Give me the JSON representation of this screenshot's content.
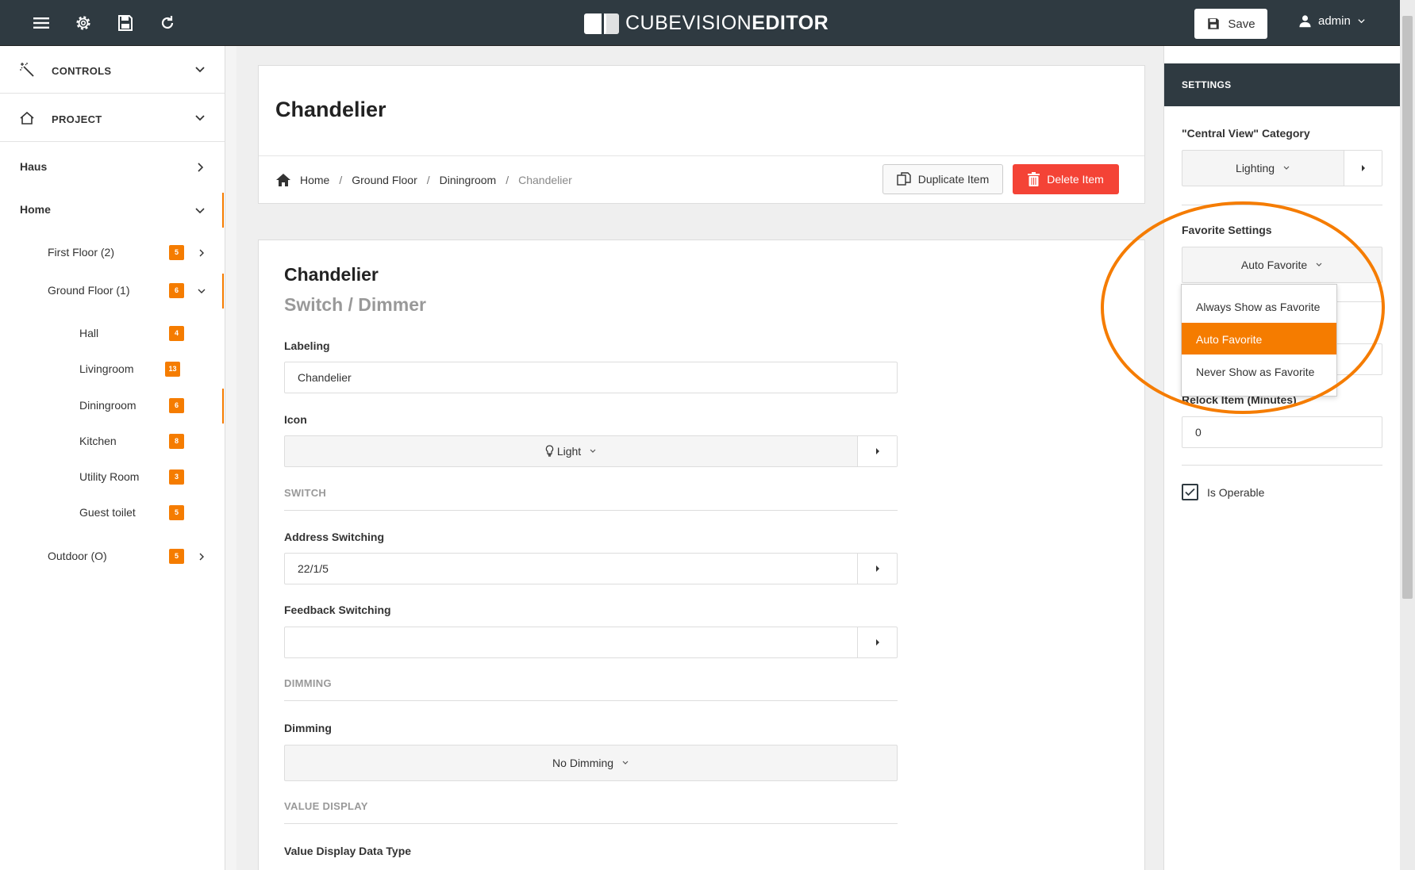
{
  "app": {
    "brand_light": "CUBEVISION",
    "brand_bold": "EDITOR"
  },
  "topbar": {
    "icons": [
      "menu-icon",
      "gear-icon",
      "floppy-icon",
      "refresh-icon"
    ],
    "save_label": "Save",
    "user_label": "admin"
  },
  "sidebar": {
    "controls_label": "CONTROLS",
    "project_label": "PROJECT",
    "items": [
      {
        "label": "Haus",
        "level": 0
      },
      {
        "label": "Home",
        "level": 0
      },
      {
        "label": "First Floor (2)",
        "badge": "5",
        "level": 1
      },
      {
        "label": "Ground Floor (1)",
        "badge": "6",
        "level": 1
      },
      {
        "label": "Hall",
        "badge": "4",
        "level": 2
      },
      {
        "label": "Livingroom",
        "badge": "13",
        "level": 2
      },
      {
        "label": "Diningroom",
        "badge": "6",
        "level": 2
      },
      {
        "label": "Kitchen",
        "badge": "8",
        "level": 2
      },
      {
        "label": "Utility Room",
        "badge": "3",
        "level": 2
      },
      {
        "label": "Guest toilet",
        "badge": "5",
        "level": 2
      },
      {
        "label": "Outdoor (O)",
        "badge": "5",
        "level": 1
      }
    ]
  },
  "page": {
    "title": "Chandelier",
    "breadcrumb": [
      "Home",
      "Ground Floor",
      "Diningroom",
      "Chandelier"
    ],
    "duplicate_label": "Duplicate Item",
    "delete_label": "Delete Item"
  },
  "form": {
    "title": "Chandelier",
    "subtitle": "Switch / Dimmer",
    "labeling_label": "Labeling",
    "labeling_value": "Chandelier",
    "icon_label": "Icon",
    "icon_value": "Light",
    "switch_section": "SWITCH",
    "address_switching_label": "Address Switching",
    "address_switching_value": "22/1/5",
    "feedback_switching_label": "Feedback Switching",
    "feedback_switching_value": "",
    "dimming_section": "DIMMING",
    "dimming_label": "Dimming",
    "dimming_value": "No Dimming",
    "value_display_section": "VALUE DISPLAY",
    "value_display_type_label": "Value Display Data Type"
  },
  "settings": {
    "header": "SETTINGS",
    "central_view_label": "\"Central View\" Category",
    "central_view_value": "Lighting",
    "favorite_label": "Favorite Settings",
    "favorite_value": "Auto Favorite",
    "favorite_options": [
      "Always Show as Favorite",
      "Auto Favorite",
      "Never Show as Favorite"
    ],
    "favorite_selected_index": 1,
    "relock_label": "Relock Item (Minutes)",
    "relock_value": "0",
    "is_operable_label": "Is Operable",
    "is_operable_checked": true
  },
  "colors": {
    "accent": "#f57c00",
    "danger": "#f44336",
    "topbar": "#2f3a41"
  }
}
